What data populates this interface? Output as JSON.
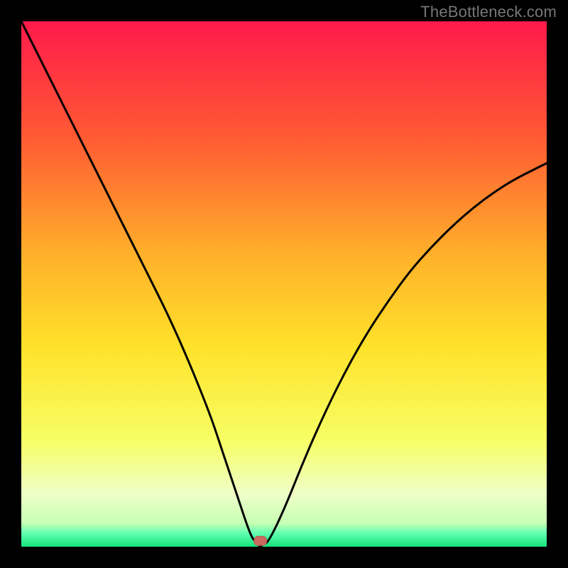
{
  "watermark": "TheBottleneck.com",
  "colors": {
    "frame": "#000000",
    "grad_top": "#ff1a4b",
    "grad_mid1": "#ff8a2a",
    "grad_mid2": "#ffd12a",
    "grad_mid3": "#faff66",
    "grad_low": "#f2ffd0",
    "grad_green": "#14e37a",
    "curve": "#000000",
    "marker_fill": "#c9695f",
    "marker_stroke": "#b35850"
  },
  "chart_data": {
    "type": "line",
    "title": "",
    "xlabel": "",
    "ylabel": "",
    "xlim": [
      0,
      100
    ],
    "ylim": [
      0,
      100
    ],
    "series": [
      {
        "name": "bottleneck-curve",
        "x": [
          0,
          4,
          8,
          12,
          16,
          20,
          24,
          28,
          32,
          36,
          38,
          40,
          42,
          43,
          44,
          45,
          46,
          47,
          50,
          54,
          58,
          62,
          66,
          70,
          74,
          78,
          82,
          86,
          90,
          94,
          98,
          100
        ],
        "y": [
          100,
          92,
          84,
          76,
          68,
          60,
          52,
          44,
          35,
          25,
          19,
          13,
          7,
          4,
          1.5,
          0.5,
          0.5,
          0.8,
          7,
          17,
          26,
          34,
          41,
          47,
          52.5,
          57,
          61,
          64.5,
          67.5,
          70,
          72,
          73
        ]
      }
    ],
    "marker": {
      "x": 45.5,
      "y": 0.5
    },
    "notch_x": 45.5,
    "gradient_stops": [
      {
        "offset": 0.0,
        "color": "#ff1a4b"
      },
      {
        "offset": 0.22,
        "color": "#ff5a33"
      },
      {
        "offset": 0.45,
        "color": "#ffb22a"
      },
      {
        "offset": 0.62,
        "color": "#ffe22a"
      },
      {
        "offset": 0.8,
        "color": "#f6ff66"
      },
      {
        "offset": 0.9,
        "color": "#eeffc8"
      },
      {
        "offset": 0.955,
        "color": "#c7ffb4"
      },
      {
        "offset": 0.975,
        "color": "#5fffb0"
      },
      {
        "offset": 1.0,
        "color": "#14e37a"
      }
    ]
  }
}
